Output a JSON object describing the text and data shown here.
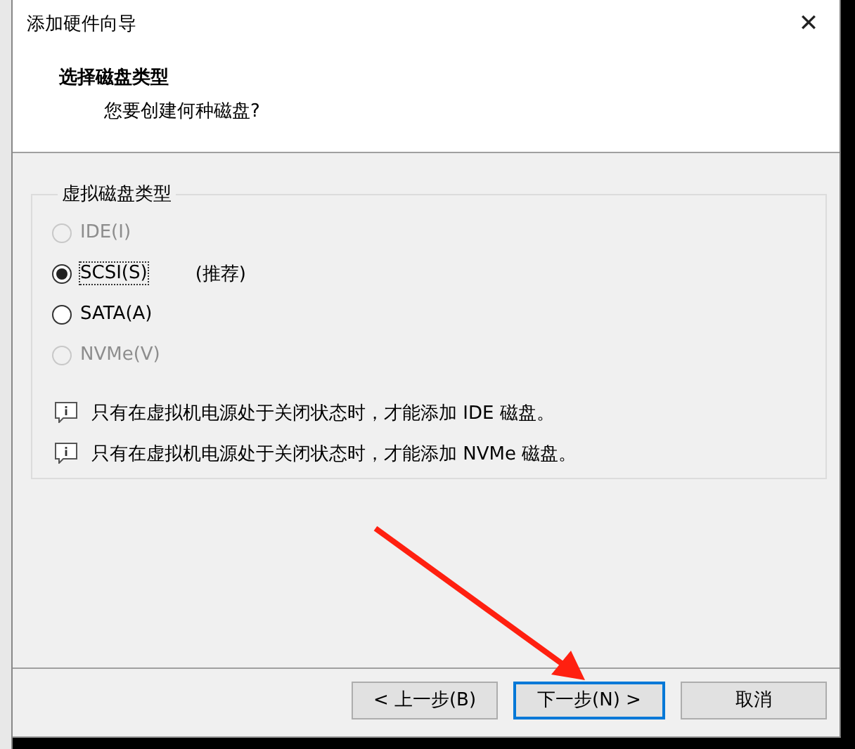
{
  "window": {
    "title": "添加硬件向导",
    "close": "✕"
  },
  "header": {
    "title": "选择磁盘类型",
    "subtitle": "您要创建何种磁盘?"
  },
  "group": {
    "legend": "虚拟磁盘类型",
    "options": [
      {
        "label": "IDE(I)",
        "selected": false,
        "disabled": true
      },
      {
        "label": "SCSI(S)",
        "selected": true,
        "disabled": false,
        "note": "(推荐)"
      },
      {
        "label": "SATA(A)",
        "selected": false,
        "disabled": false
      },
      {
        "label": "NVMe(V)",
        "selected": false,
        "disabled": true
      }
    ],
    "notes": [
      "只有在虚拟机电源处于关闭状态时，才能添加 IDE 磁盘。",
      "只有在虚拟机电源处于关闭状态时，才能添加 NVMe 磁盘。"
    ]
  },
  "buttons": [
    {
      "label": "< 上一步(B)",
      "default": false
    },
    {
      "label": "下一步(N) >",
      "default": true
    },
    {
      "label": "取消",
      "default": false
    }
  ]
}
